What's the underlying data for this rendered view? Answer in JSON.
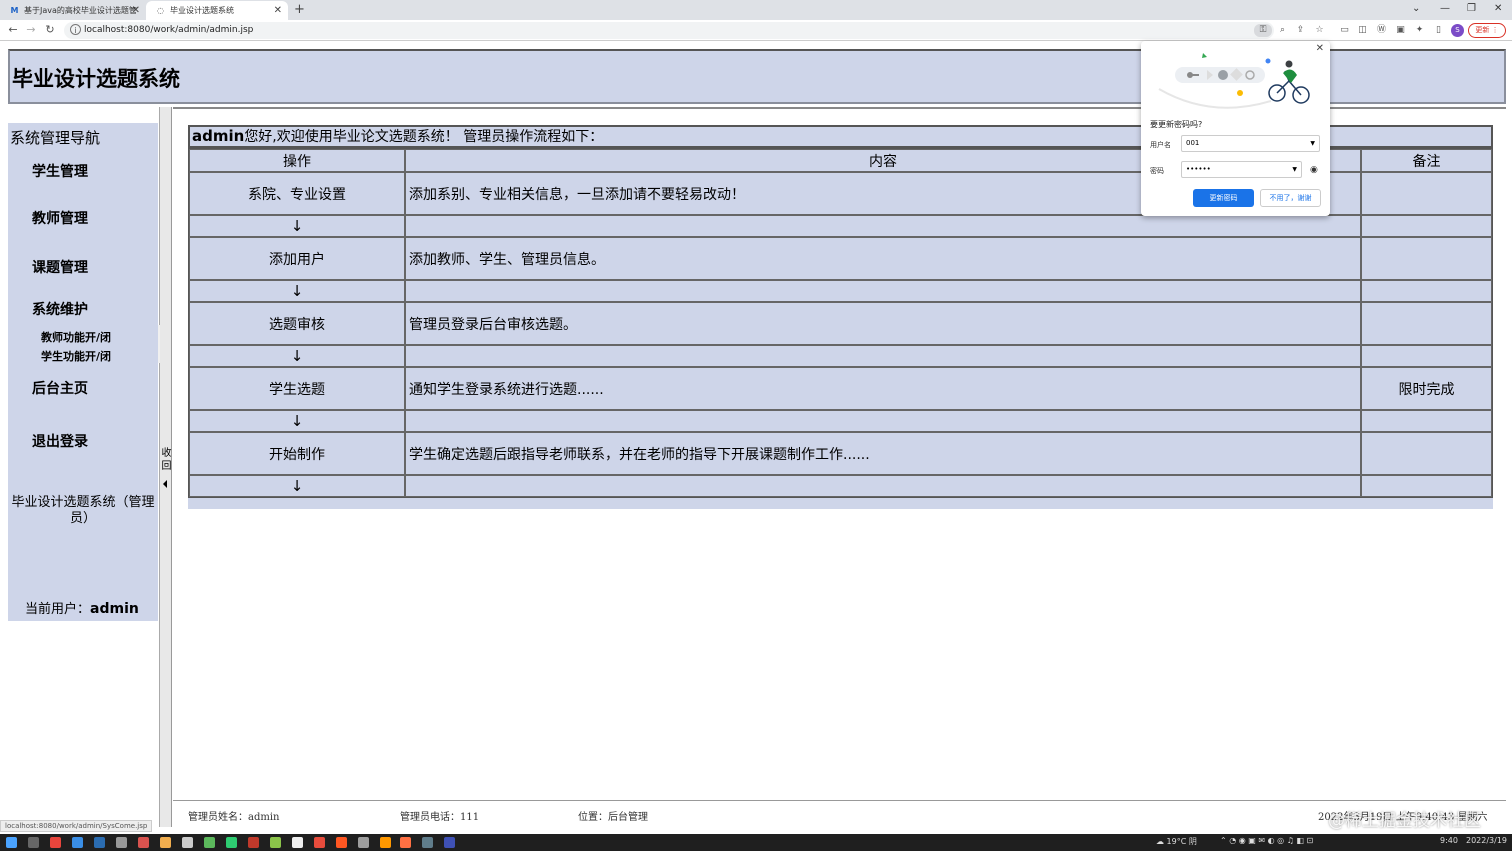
{
  "browser": {
    "tabs": [
      {
        "title": "基于Java的高校毕业设计选题管",
        "icon": "M"
      },
      {
        "title": "毕业设计选题系统",
        "icon": "◌"
      }
    ],
    "url": "localhost:8080/work/admin/admin.jsp",
    "profile_initial": "S",
    "update_label": "更新"
  },
  "header": {
    "title": "毕业设计选题系统"
  },
  "sidebar": {
    "title": "系统管理导航",
    "items": [
      {
        "label": "学生管理"
      },
      {
        "label": "教师管理"
      },
      {
        "label": "课题管理"
      },
      {
        "label": "系统维护"
      },
      {
        "label": "后台主页"
      },
      {
        "label": "退出登录"
      }
    ],
    "subitems": [
      {
        "label": "教师功能开/闭"
      },
      {
        "label": "学生功能开/闭"
      }
    ],
    "system_name": "毕业设计选题系统（管理员）",
    "current_user_label": "当前用户：",
    "current_user": "admin"
  },
  "collapse": {
    "label": "收回"
  },
  "welcome": {
    "user": "admin",
    "text": "您好,欢迎使用毕业论文选题系统！  管理员操作流程如下："
  },
  "table": {
    "headers": [
      "操作",
      "内容",
      "备注"
    ],
    "steps": [
      {
        "op": "系院、专业设置",
        "content": "添加系别、专业相关信息，一旦添加请不要轻易改动！",
        "note": ""
      },
      {
        "op": "添加用户",
        "content": "添加教师、学生、管理员信息。",
        "note": ""
      },
      {
        "op": "选题审核",
        "content": "管理员登录后台审核选题。",
        "note": ""
      },
      {
        "op": "学生选题",
        "content": "通知学生登录系统进行选题......",
        "note": "限时完成"
      },
      {
        "op": "开始制作",
        "content": "学生确定选题后跟指导老师联系，并在老师的指导下开展课题制作工作......",
        "note": ""
      }
    ],
    "arrow": "↓"
  },
  "status": {
    "admin_name": "管理员姓名：admin",
    "admin_phone": "管理员电话：111",
    "location": "位置：后台管理",
    "datetime": "2022年3月19日 上午9:40:43 星期六"
  },
  "link_hint": "localhost:8080/work/admin/SysCome.jsp",
  "password_popup": {
    "question": "要更新密码吗?",
    "username_label": "用户名",
    "username_value": "001",
    "password_label": "密码",
    "password_value": "••••••",
    "update_button": "更新密码",
    "dismiss_button": "不用了，谢谢"
  },
  "taskbar": {
    "weather": "19°C 阴",
    "time": "9:40",
    "date": "2022/3/19"
  },
  "watermark": "@稀土掘金技术社区",
  "colors": {
    "panel": "#ced5e9",
    "primary": "#1a73e8"
  }
}
